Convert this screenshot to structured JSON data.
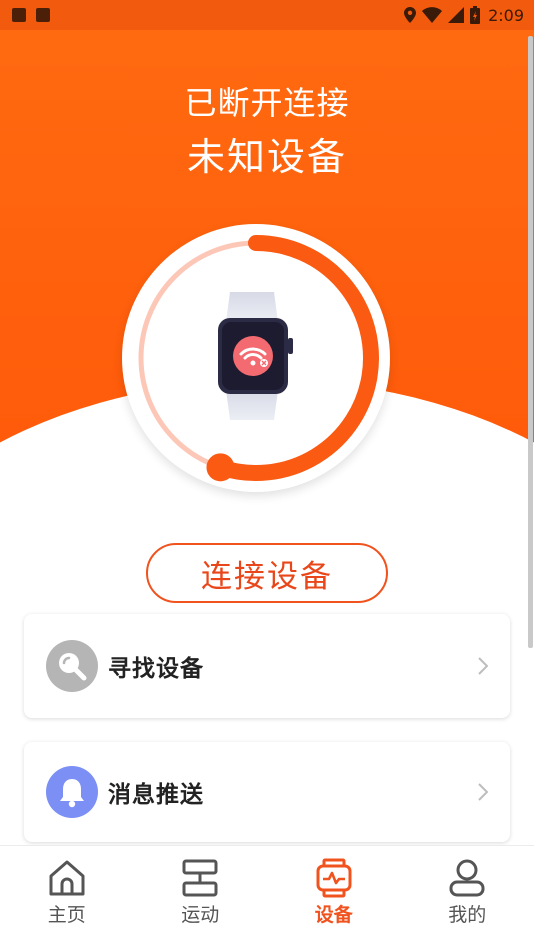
{
  "status_bar": {
    "time": "2:09"
  },
  "header": {
    "status_text": "已断开连接",
    "device_name": "未知设备"
  },
  "ring": {
    "progress_fraction": 0.55
  },
  "connect_button": {
    "label": "连接设备"
  },
  "cards": [
    {
      "label": "寻找设备",
      "icon": "search-icon"
    },
    {
      "label": "消息推送",
      "icon": "bell-icon"
    }
  ],
  "bottom_nav": {
    "items": [
      {
        "label": "主页",
        "icon": "home-icon"
      },
      {
        "label": "运动",
        "icon": "sport-icon"
      },
      {
        "label": "设备",
        "icon": "device-icon",
        "active": true
      },
      {
        "label": "我的",
        "icon": "user-icon"
      }
    ]
  },
  "colors": {
    "accent": "#f0531e",
    "header": "#ff6a10",
    "ring_light": "#fdc7b7",
    "bell_bg": "#7b8ff5",
    "search_bg": "#b5b5b5"
  }
}
